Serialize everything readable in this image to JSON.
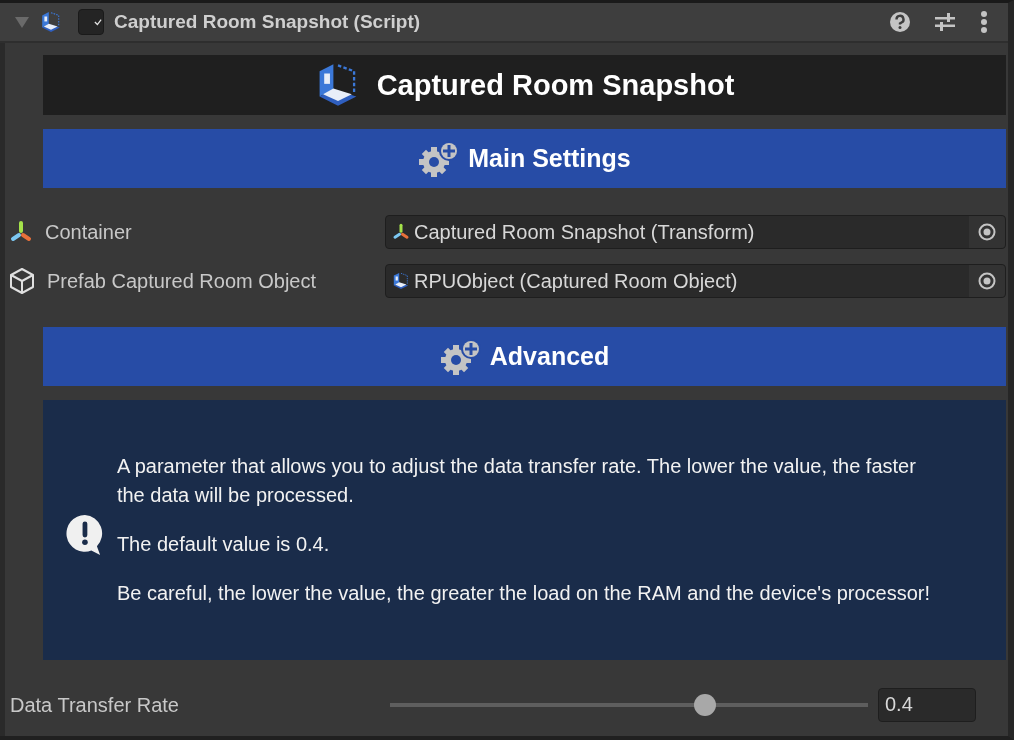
{
  "component": {
    "expanded": true,
    "enabled": true,
    "title": "Captured Room Snapshot (Script)"
  },
  "banner": {
    "title": "Captured Room Snapshot"
  },
  "sections": [
    {
      "title": "Main Settings"
    },
    {
      "title": "Advanced"
    }
  ],
  "fields": [
    {
      "kind": "transform",
      "label": "Container",
      "value": "Captured Room Snapshot (Transform)"
    },
    {
      "kind": "prefab",
      "label": "Prefab Captured Room Object",
      "value": "RPUObject (Captured Room Object)"
    }
  ],
  "help_box": {
    "paragraphs": [
      "A parameter that allows you to adjust the data transfer rate. The lower the value, the faster the data will be processed.",
      "The default value is 0.4.",
      "Be careful, the lower the value, the greater the load on the RAM and the device's processor!"
    ]
  },
  "slider": {
    "label": "Data Transfer Rate",
    "level": 0.66,
    "value": "0.4"
  }
}
